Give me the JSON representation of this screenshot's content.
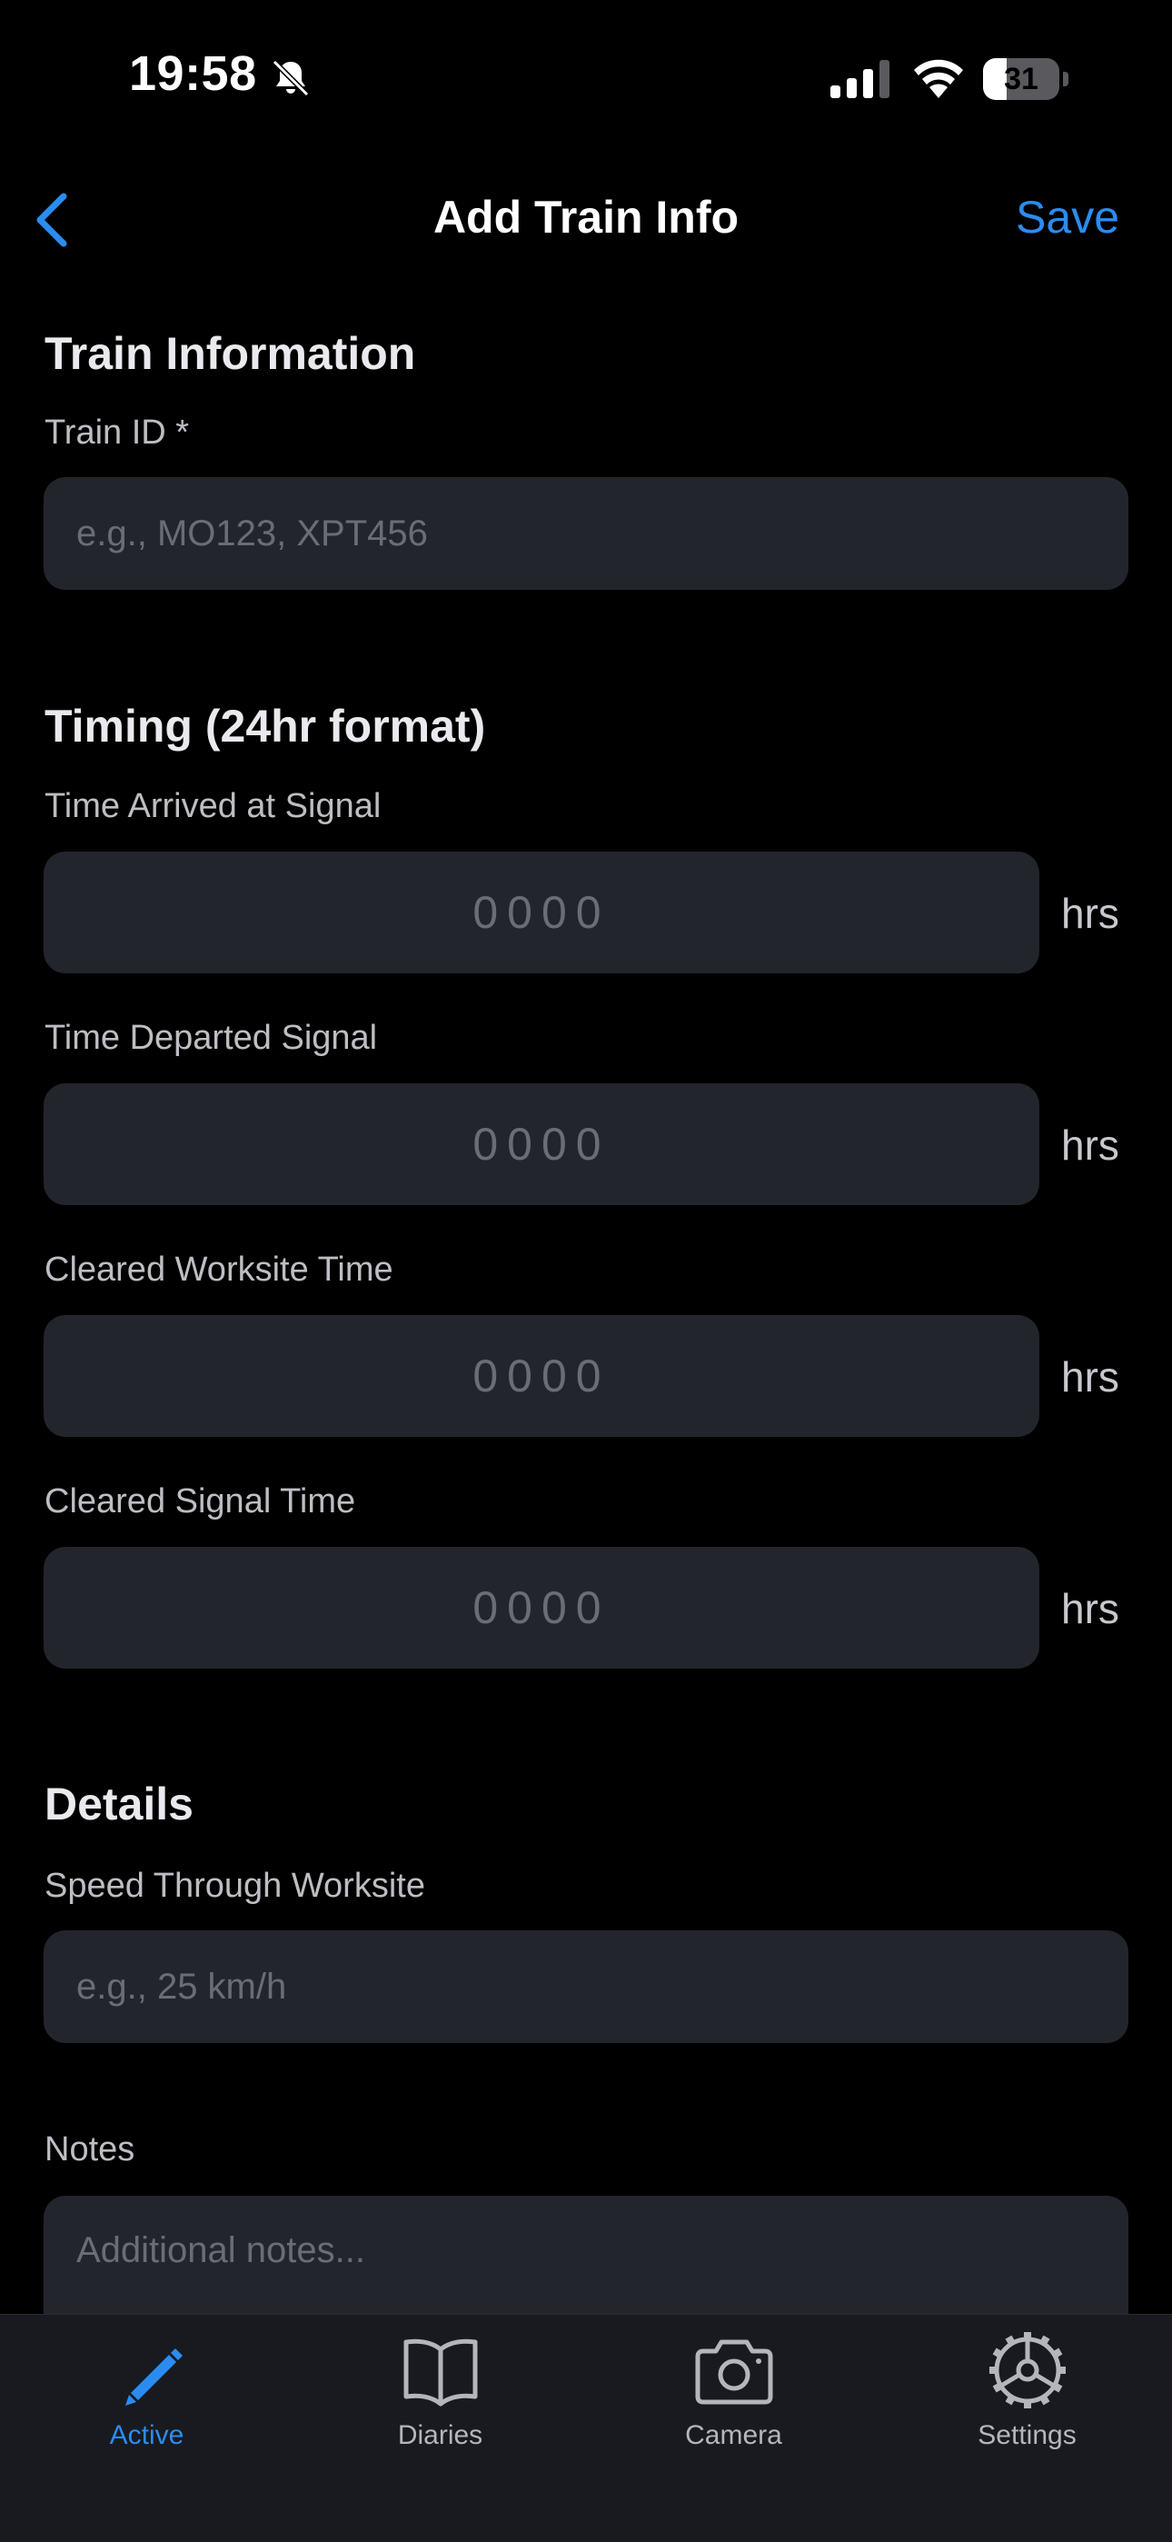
{
  "status_bar": {
    "time": "19:58",
    "battery_level": "31",
    "battery_fraction": 0.31
  },
  "nav": {
    "back_icon": "chevron-left-icon",
    "title": "Add Train Info",
    "save_label": "Save"
  },
  "train_information": {
    "section_title": "Train Information",
    "train_id_label": "Train ID *",
    "train_id_placeholder": "e.g., MO123, XPT456"
  },
  "timing": {
    "section_title": "Timing (24hr format)",
    "fields": [
      {
        "label": "Time Arrived at Signal",
        "placeholder": "0000",
        "unit": "hrs"
      },
      {
        "label": "Time Departed Signal",
        "placeholder": "0000",
        "unit": "hrs"
      },
      {
        "label": "Cleared Worksite Time",
        "placeholder": "0000",
        "unit": "hrs"
      },
      {
        "label": "Cleared Signal Time",
        "placeholder": "0000",
        "unit": "hrs"
      }
    ]
  },
  "details": {
    "section_title": "Details",
    "speed_label": "Speed Through Worksite",
    "speed_placeholder": "e.g., 25 km/h",
    "notes_label": "Notes",
    "notes_placeholder": "Additional notes..."
  },
  "tab_bar": {
    "tabs": [
      {
        "label": "Active",
        "icon": "pencil-icon",
        "active": true
      },
      {
        "label": "Diaries",
        "icon": "book-icon",
        "active": false
      },
      {
        "label": "Camera",
        "icon": "camera-icon",
        "active": false
      },
      {
        "label": "Settings",
        "icon": "gear-icon",
        "active": false
      }
    ]
  },
  "colors": {
    "accent": "#2b8cf0",
    "background": "#000000",
    "field_background": "#23252c",
    "tab_bar_background": "#181a20"
  }
}
